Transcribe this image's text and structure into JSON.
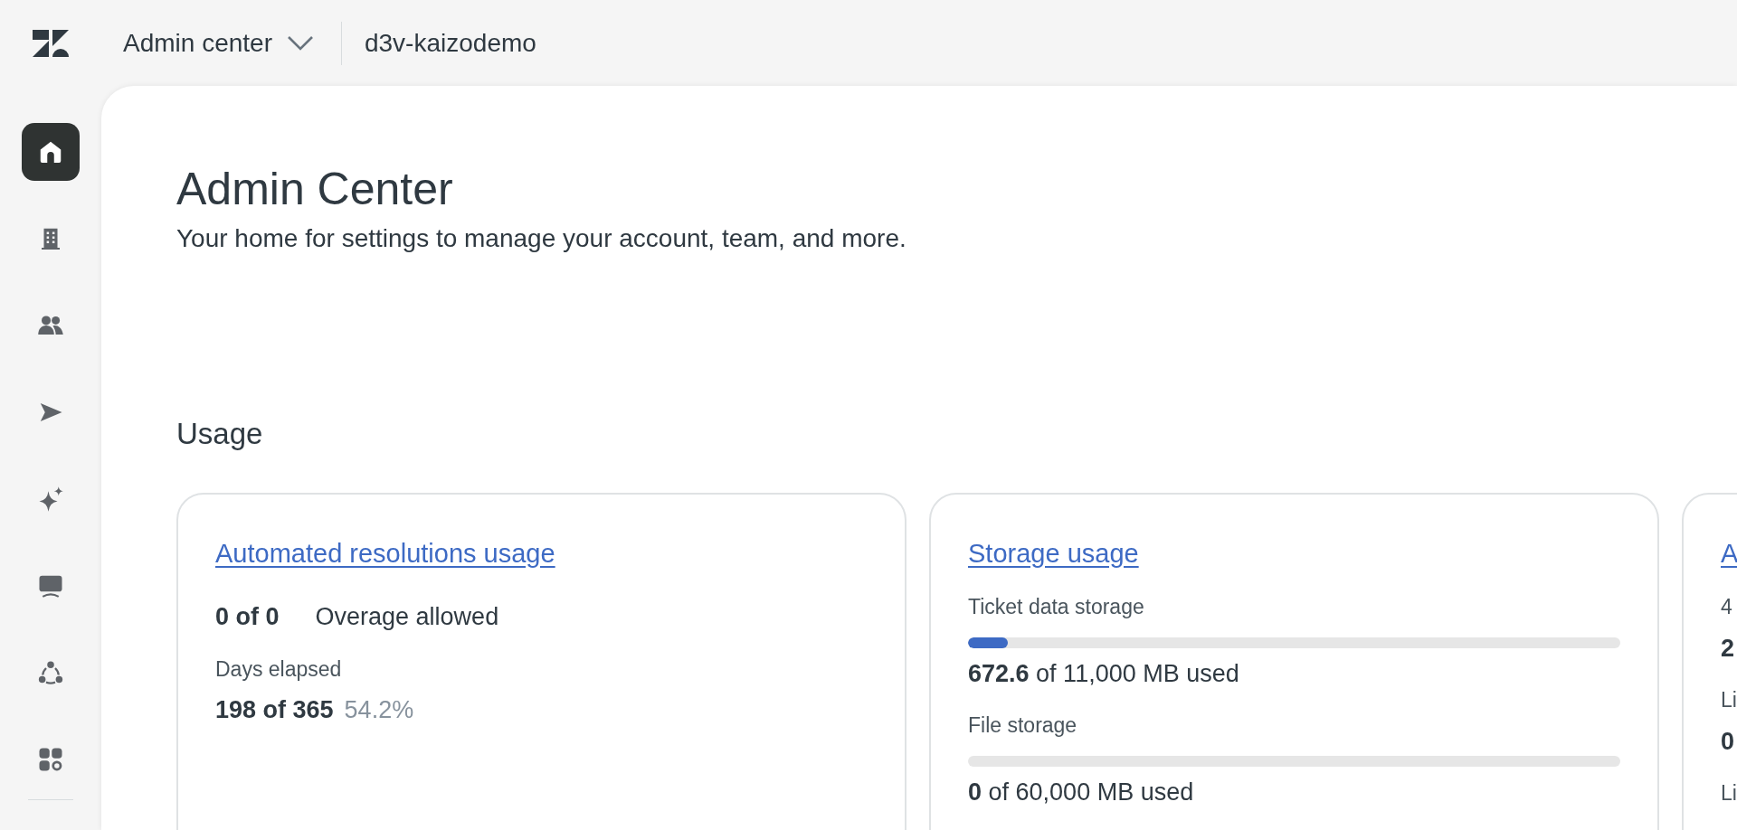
{
  "header": {
    "product_menu": "Admin center",
    "account": "d3v-kaizodemo"
  },
  "sidebar": {
    "items": [
      {
        "kind": "home",
        "selected": true
      },
      {
        "kind": "building",
        "selected": false
      },
      {
        "kind": "people",
        "selected": false
      },
      {
        "kind": "send",
        "selected": false
      },
      {
        "kind": "sparkle",
        "selected": false
      },
      {
        "kind": "monitor",
        "selected": false
      },
      {
        "kind": "nodes",
        "selected": false
      },
      {
        "kind": "apps",
        "selected": false
      }
    ]
  },
  "page": {
    "title": "Admin Center",
    "subtitle": "Your home for settings to manage your account, team, and more.",
    "section": "Usage",
    "cards": [
      {
        "title": "Automated resolutions usage",
        "rows": [
          {
            "kind": "pair",
            "strong": "0 of 0",
            "text": "Overage allowed",
            "muted": false
          },
          {
            "kind": "label",
            "text": "Days elapsed"
          },
          {
            "kind": "pair",
            "strong": "198 of 365",
            "text": "54.2%",
            "muted": true
          }
        ]
      },
      {
        "title": "Storage usage",
        "rows": [
          {
            "kind": "label",
            "text": "Ticket data storage"
          },
          {
            "kind": "meter",
            "level": 0.061
          },
          {
            "kind": "usage",
            "strong": "672.6",
            "text": "of 11,000 MB used"
          },
          {
            "kind": "label",
            "text": "File storage"
          },
          {
            "kind": "meter"
          },
          {
            "kind": "usage",
            "strong": "0",
            "text": "of 60,000 MB used"
          }
        ]
      },
      {
        "title": "A",
        "rows": [
          {
            "kind": "label",
            "text": "4"
          },
          {
            "kind": "value",
            "text": "2"
          },
          {
            "kind": "label",
            "text": "Li"
          },
          {
            "kind": "value",
            "text": "0"
          },
          {
            "kind": "label",
            "text": "Li"
          }
        ]
      }
    ]
  }
}
